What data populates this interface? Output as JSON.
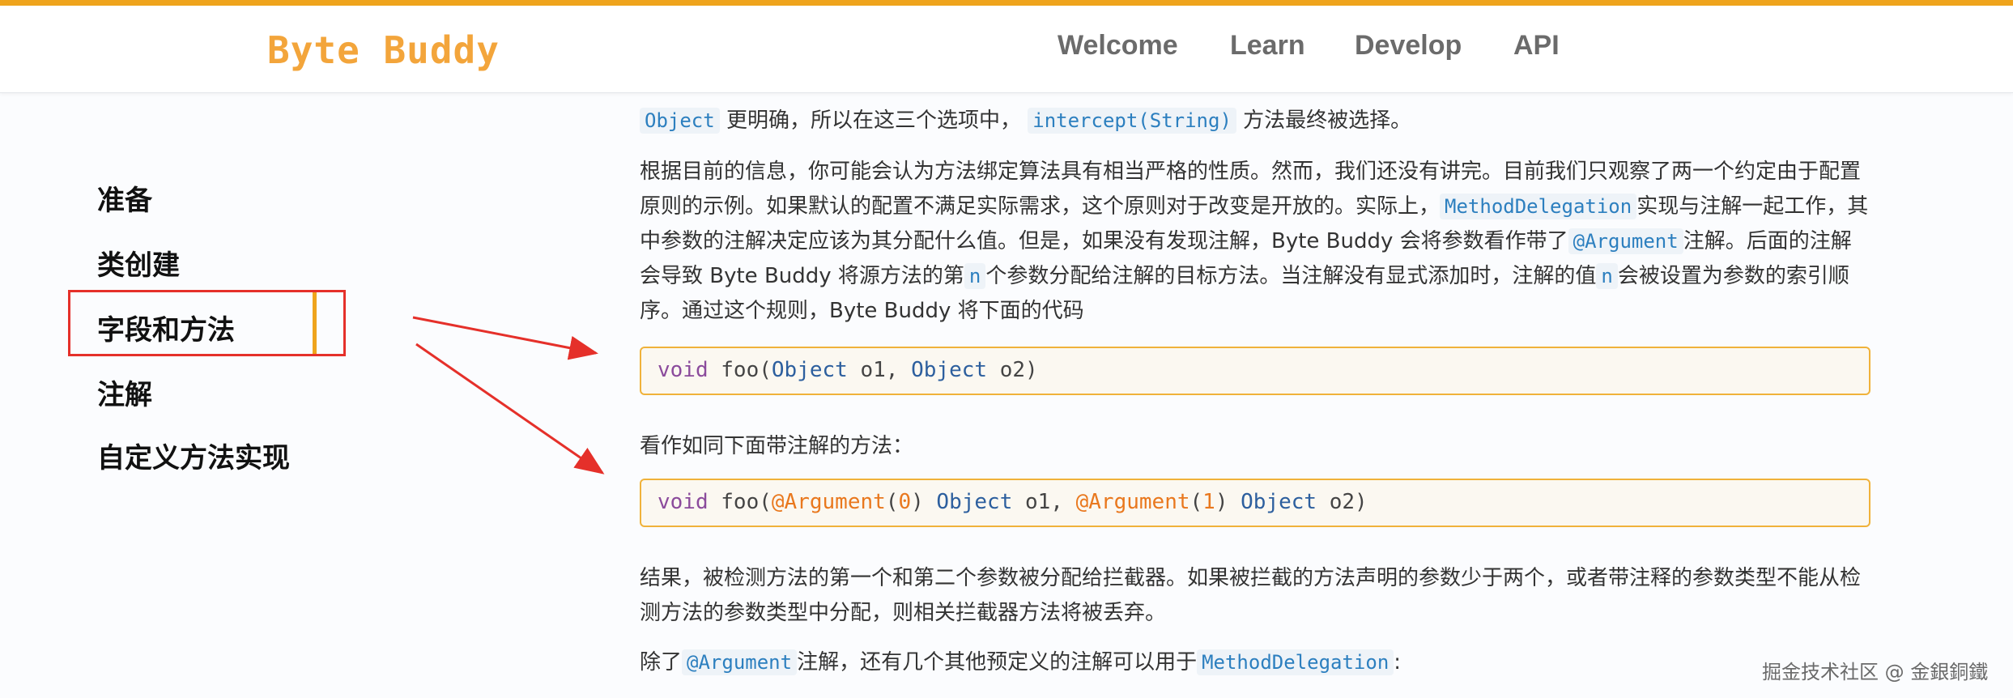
{
  "header": {
    "logo": "Byte Buddy",
    "nav": [
      "Welcome",
      "Learn",
      "Develop",
      "API"
    ]
  },
  "sidebar": {
    "items": [
      "准备",
      "类创建",
      "字段和方法",
      "注解",
      "自定义方法实现"
    ],
    "active_index": 2
  },
  "content": {
    "p0": {
      "c0": "Object",
      "t1": "更明确，所以在这三个选项中，",
      "c1": "intercept(String)",
      "t2": "方法最终被选择。"
    },
    "p1": {
      "t1": "根据目前的信息，你可能会认为方法绑定算法具有相当严格的性质。然而，我们还没有讲完。目前我们只观察了两一个约定由于配置原则的示例。如果默认的配置不满足实际需求，这个原则对于改变是开放的。实际上，",
      "c1": "MethodDelegation",
      "t2": "实现与注解一起工作，其中参数的注解决定应该为其分配什么值。但是，如果没有发现注解，Byte Buddy 会将参数看作带了",
      "c2": "@Argument",
      "t3": "注解。后面的注解会导致 Byte Buddy 将源方法的第",
      "c3": "n",
      "t4": "个参数分配给注解的目标方法。当注解没有显式添加时，注解的值",
      "c4": "n",
      "t5": "会被设置为参数的索引顺序。通过这个规则，Byte Buddy 将下面的代码"
    },
    "code1": {
      "kw": "void",
      "name": "foo(",
      "t1": "Object",
      "a1": "o1,",
      "t2": "Object",
      "a2": "o2)"
    },
    "p2": "看作如同下面带注解的方法：",
    "code2": {
      "kw": "void",
      "name": "foo(",
      "ann1": "@Argument",
      "lp1": "(",
      "n1": "0",
      "rp1": ")",
      "t1": "Object",
      "a1": "o1,",
      "ann2": "@Argument",
      "lp2": "(",
      "n2": "1",
      "rp2": ")",
      "t2": "Object",
      "a2": "o2)"
    },
    "p3": "结果，被检测方法的第一个和第二个参数被分配给拦截器。如果被拦截的方法声明的参数少于两个，或者带注释的参数类型不能从检测方法的参数类型中分配，则相关拦截器方法将被丢弃。",
    "p4": {
      "t1": "除了",
      "c1": "@Argument",
      "t2": "注解，还有几个其他预定义的注解可以用于",
      "c2": "MethodDelegation",
      "t3": ":"
    }
  },
  "watermark": "掘金技术社区 @ 金銀銅鐵",
  "colors": {
    "accent": "#efa41c",
    "annotation_box": "#e5302a",
    "annotation_arrow": "#e5302a"
  }
}
